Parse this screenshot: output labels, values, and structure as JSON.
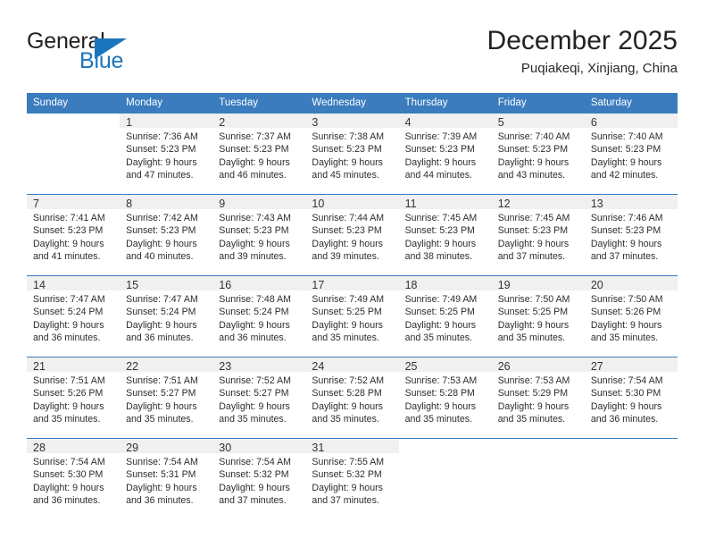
{
  "brand": {
    "word_one": "General",
    "word_two": "Blue",
    "triangle_icon": "triangle-icon",
    "accent_color": "#1b75bc"
  },
  "header": {
    "month_title": "December 2025",
    "location": "Puqiakeqi, Xinjiang, China"
  },
  "calendar": {
    "header_bg_color": "#3a7cbe",
    "daynum_bg_color": "#f0f0f0",
    "weekday_headers": [
      "Sunday",
      "Monday",
      "Tuesday",
      "Wednesday",
      "Thursday",
      "Friday",
      "Saturday"
    ],
    "weeks": [
      [
        {
          "day": "",
          "sunrise": "",
          "sunset": "",
          "daylight_a": "",
          "daylight_b": ""
        },
        {
          "day": "1",
          "sunrise": "Sunrise: 7:36 AM",
          "sunset": "Sunset: 5:23 PM",
          "daylight_a": "Daylight: 9 hours",
          "daylight_b": "and 47 minutes."
        },
        {
          "day": "2",
          "sunrise": "Sunrise: 7:37 AM",
          "sunset": "Sunset: 5:23 PM",
          "daylight_a": "Daylight: 9 hours",
          "daylight_b": "and 46 minutes."
        },
        {
          "day": "3",
          "sunrise": "Sunrise: 7:38 AM",
          "sunset": "Sunset: 5:23 PM",
          "daylight_a": "Daylight: 9 hours",
          "daylight_b": "and 45 minutes."
        },
        {
          "day": "4",
          "sunrise": "Sunrise: 7:39 AM",
          "sunset": "Sunset: 5:23 PM",
          "daylight_a": "Daylight: 9 hours",
          "daylight_b": "and 44 minutes."
        },
        {
          "day": "5",
          "sunrise": "Sunrise: 7:40 AM",
          "sunset": "Sunset: 5:23 PM",
          "daylight_a": "Daylight: 9 hours",
          "daylight_b": "and 43 minutes."
        },
        {
          "day": "6",
          "sunrise": "Sunrise: 7:40 AM",
          "sunset": "Sunset: 5:23 PM",
          "daylight_a": "Daylight: 9 hours",
          "daylight_b": "and 42 minutes."
        }
      ],
      [
        {
          "day": "7",
          "sunrise": "Sunrise: 7:41 AM",
          "sunset": "Sunset: 5:23 PM",
          "daylight_a": "Daylight: 9 hours",
          "daylight_b": "and 41 minutes."
        },
        {
          "day": "8",
          "sunrise": "Sunrise: 7:42 AM",
          "sunset": "Sunset: 5:23 PM",
          "daylight_a": "Daylight: 9 hours",
          "daylight_b": "and 40 minutes."
        },
        {
          "day": "9",
          "sunrise": "Sunrise: 7:43 AM",
          "sunset": "Sunset: 5:23 PM",
          "daylight_a": "Daylight: 9 hours",
          "daylight_b": "and 39 minutes."
        },
        {
          "day": "10",
          "sunrise": "Sunrise: 7:44 AM",
          "sunset": "Sunset: 5:23 PM",
          "daylight_a": "Daylight: 9 hours",
          "daylight_b": "and 39 minutes."
        },
        {
          "day": "11",
          "sunrise": "Sunrise: 7:45 AM",
          "sunset": "Sunset: 5:23 PM",
          "daylight_a": "Daylight: 9 hours",
          "daylight_b": "and 38 minutes."
        },
        {
          "day": "12",
          "sunrise": "Sunrise: 7:45 AM",
          "sunset": "Sunset: 5:23 PM",
          "daylight_a": "Daylight: 9 hours",
          "daylight_b": "and 37 minutes."
        },
        {
          "day": "13",
          "sunrise": "Sunrise: 7:46 AM",
          "sunset": "Sunset: 5:23 PM",
          "daylight_a": "Daylight: 9 hours",
          "daylight_b": "and 37 minutes."
        }
      ],
      [
        {
          "day": "14",
          "sunrise": "Sunrise: 7:47 AM",
          "sunset": "Sunset: 5:24 PM",
          "daylight_a": "Daylight: 9 hours",
          "daylight_b": "and 36 minutes."
        },
        {
          "day": "15",
          "sunrise": "Sunrise: 7:47 AM",
          "sunset": "Sunset: 5:24 PM",
          "daylight_a": "Daylight: 9 hours",
          "daylight_b": "and 36 minutes."
        },
        {
          "day": "16",
          "sunrise": "Sunrise: 7:48 AM",
          "sunset": "Sunset: 5:24 PM",
          "daylight_a": "Daylight: 9 hours",
          "daylight_b": "and 36 minutes."
        },
        {
          "day": "17",
          "sunrise": "Sunrise: 7:49 AM",
          "sunset": "Sunset: 5:25 PM",
          "daylight_a": "Daylight: 9 hours",
          "daylight_b": "and 35 minutes."
        },
        {
          "day": "18",
          "sunrise": "Sunrise: 7:49 AM",
          "sunset": "Sunset: 5:25 PM",
          "daylight_a": "Daylight: 9 hours",
          "daylight_b": "and 35 minutes."
        },
        {
          "day": "19",
          "sunrise": "Sunrise: 7:50 AM",
          "sunset": "Sunset: 5:25 PM",
          "daylight_a": "Daylight: 9 hours",
          "daylight_b": "and 35 minutes."
        },
        {
          "day": "20",
          "sunrise": "Sunrise: 7:50 AM",
          "sunset": "Sunset: 5:26 PM",
          "daylight_a": "Daylight: 9 hours",
          "daylight_b": "and 35 minutes."
        }
      ],
      [
        {
          "day": "21",
          "sunrise": "Sunrise: 7:51 AM",
          "sunset": "Sunset: 5:26 PM",
          "daylight_a": "Daylight: 9 hours",
          "daylight_b": "and 35 minutes."
        },
        {
          "day": "22",
          "sunrise": "Sunrise: 7:51 AM",
          "sunset": "Sunset: 5:27 PM",
          "daylight_a": "Daylight: 9 hours",
          "daylight_b": "and 35 minutes."
        },
        {
          "day": "23",
          "sunrise": "Sunrise: 7:52 AM",
          "sunset": "Sunset: 5:27 PM",
          "daylight_a": "Daylight: 9 hours",
          "daylight_b": "and 35 minutes."
        },
        {
          "day": "24",
          "sunrise": "Sunrise: 7:52 AM",
          "sunset": "Sunset: 5:28 PM",
          "daylight_a": "Daylight: 9 hours",
          "daylight_b": "and 35 minutes."
        },
        {
          "day": "25",
          "sunrise": "Sunrise: 7:53 AM",
          "sunset": "Sunset: 5:28 PM",
          "daylight_a": "Daylight: 9 hours",
          "daylight_b": "and 35 minutes."
        },
        {
          "day": "26",
          "sunrise": "Sunrise: 7:53 AM",
          "sunset": "Sunset: 5:29 PM",
          "daylight_a": "Daylight: 9 hours",
          "daylight_b": "and 35 minutes."
        },
        {
          "day": "27",
          "sunrise": "Sunrise: 7:54 AM",
          "sunset": "Sunset: 5:30 PM",
          "daylight_a": "Daylight: 9 hours",
          "daylight_b": "and 36 minutes."
        }
      ],
      [
        {
          "day": "28",
          "sunrise": "Sunrise: 7:54 AM",
          "sunset": "Sunset: 5:30 PM",
          "daylight_a": "Daylight: 9 hours",
          "daylight_b": "and 36 minutes."
        },
        {
          "day": "29",
          "sunrise": "Sunrise: 7:54 AM",
          "sunset": "Sunset: 5:31 PM",
          "daylight_a": "Daylight: 9 hours",
          "daylight_b": "and 36 minutes."
        },
        {
          "day": "30",
          "sunrise": "Sunrise: 7:54 AM",
          "sunset": "Sunset: 5:32 PM",
          "daylight_a": "Daylight: 9 hours",
          "daylight_b": "and 37 minutes."
        },
        {
          "day": "31",
          "sunrise": "Sunrise: 7:55 AM",
          "sunset": "Sunset: 5:32 PM",
          "daylight_a": "Daylight: 9 hours",
          "daylight_b": "and 37 minutes."
        },
        {
          "day": "",
          "sunrise": "",
          "sunset": "",
          "daylight_a": "",
          "daylight_b": ""
        },
        {
          "day": "",
          "sunrise": "",
          "sunset": "",
          "daylight_a": "",
          "daylight_b": ""
        },
        {
          "day": "",
          "sunrise": "",
          "sunset": "",
          "daylight_a": "",
          "daylight_b": ""
        }
      ]
    ]
  }
}
